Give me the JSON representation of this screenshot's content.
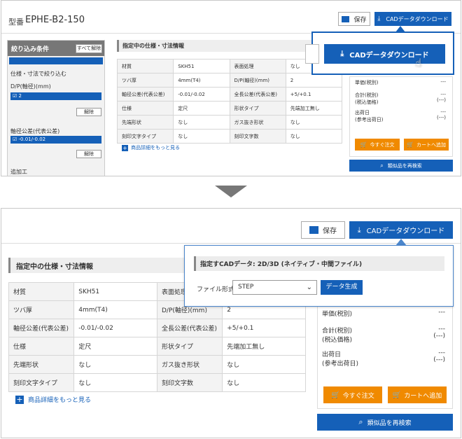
{
  "top": {
    "model_label": "型番",
    "model_value": "EPHE-B2-150",
    "save_label": "保存",
    "cad_label": "CADデータダウンロード",
    "cad_big_label": "CADデータダウンロード",
    "sidebar": {
      "title": "絞り込み条件",
      "clear_all": "すべて解除",
      "subtitle": "仕様・寸法で絞り込む",
      "group1": "D/P(軸径)(mm)",
      "group1_value": "2",
      "group2": "軸径公差(代表公差)",
      "group2_value": "-0.01/-0.02",
      "release": "解除",
      "group3": "追加工"
    },
    "spec_title": "指定中の仕様・寸法情報",
    "rows": [
      [
        "材質",
        "SKH51",
        "表面処理",
        "なし"
      ],
      [
        "ツバ厚",
        "4mm(T4)",
        "D/P(軸径)(mm)",
        "2"
      ],
      [
        "軸径公差(代表公差)",
        "-0.01/-0.02",
        "全長公差(代表公差)",
        "+5/+0.1"
      ],
      [
        "仕様",
        "定尺",
        "形状タイプ",
        "先端加工無し"
      ],
      [
        "先端形状",
        "なし",
        "ガス抜き形状",
        "なし"
      ],
      [
        "刻印文字タイプ",
        "なし",
        "刻印文字数",
        "なし"
      ]
    ],
    "more": "商品詳細をもっと見る",
    "price": [
      {
        "label": "単価(税別)",
        "value": "---"
      },
      {
        "label": "合計(税別)",
        "sub": "(税込価格)",
        "value": "---",
        "sub_value": "(---)"
      },
      {
        "label": "出荷日",
        "sub": "(参考出荷日)",
        "value": "---",
        "sub_value": "(---)"
      }
    ],
    "order_now": "今すぐ注文",
    "add_cart": "カートへ追加",
    "similar": "類似品を再検索"
  },
  "bottom": {
    "save_label": "保存",
    "cad_label": "CADデータダウンロード",
    "spec_title": "指定中の仕様・寸法情報",
    "rows": [
      [
        "材質",
        "SKH51",
        "表面処理",
        ""
      ],
      [
        "ツバ厚",
        "4mm(T4)",
        "D/P(軸径)(mm)",
        "2"
      ],
      [
        "軸径公差(代表公差)",
        "-0.01/-0.02",
        "全長公差(代表公差)",
        "+5/+0.1"
      ],
      [
        "仕様",
        "定尺",
        "形状タイプ",
        "先端加工無し"
      ],
      [
        "先端形状",
        "なし",
        "ガス抜き形状",
        "なし"
      ],
      [
        "刻印文字タイプ",
        "なし",
        "刻印文字数",
        "なし"
      ]
    ],
    "more": "商品詳細をもっと見る",
    "popup_title": "指定すCADデータ: 2D/3D (ネイティブ・中間ファイル)",
    "format_label": "ファイル形式",
    "format_value": "STEP",
    "generate": "データ生成",
    "price": [
      {
        "label": "単価(税別)",
        "value": "---"
      },
      {
        "label": "合計(税別)",
        "sub": "(税込価格)",
        "value": "---",
        "sub_value": "(---)"
      },
      {
        "label": "出荷日",
        "sub": "(参考出荷日)",
        "value": "---",
        "sub_value": "(---)"
      }
    ],
    "order_now": "今すぐ注文",
    "add_cart": "カートへ追加",
    "similar": "類似品を再検索"
  }
}
